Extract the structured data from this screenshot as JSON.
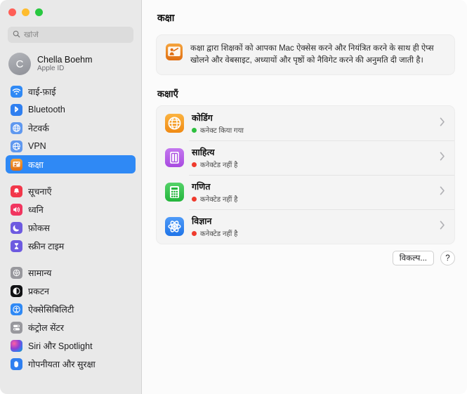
{
  "window": {
    "traffic_lights": [
      "close",
      "minimize",
      "maximize"
    ],
    "accent_color": "#2f89f5"
  },
  "sidebar": {
    "search": {
      "placeholder": "खोजें",
      "value": "",
      "icon": "search-icon"
    },
    "account": {
      "initial": "C",
      "name": "Chella Boehm",
      "subtitle": "Apple ID"
    },
    "groups": [
      {
        "items": [
          {
            "label": "वाई-फ़ाई",
            "icon": "wifi-icon",
            "color": "#2f89f5",
            "selected": false
          },
          {
            "label": "Bluetooth",
            "icon": "bluetooth-icon",
            "color": "#2f7ff0",
            "selected": false
          },
          {
            "label": "नेटवर्क",
            "icon": "network-globe-icon",
            "color": "#4a8ff0",
            "selected": false
          },
          {
            "label": "VPN",
            "icon": "vpn-globe-icon",
            "color": "#4a8ff0",
            "selected": false
          },
          {
            "label": "कक्षा",
            "icon": "classroom-icon",
            "color": "#e8801a",
            "selected": true
          }
        ]
      },
      {
        "items": [
          {
            "label": "सूचनाएँ",
            "icon": "notifications-bell-icon",
            "color": "#f2374a",
            "selected": false
          },
          {
            "label": "ध्वनि",
            "icon": "sound-speaker-icon",
            "color": "#f1355f",
            "selected": false
          },
          {
            "label": "फ़ोकस",
            "icon": "focus-moon-icon",
            "color": "#6d5ae0",
            "selected": false
          },
          {
            "label": "स्क्रीन टाइम",
            "icon": "screen-time-hourglass-icon",
            "color": "#6d5ae0",
            "selected": false
          }
        ]
      },
      {
        "items": [
          {
            "label": "सामान्य",
            "icon": "general-gear-icon",
            "color": "#98989d",
            "selected": false
          },
          {
            "label": "प्रकटन",
            "icon": "appearance-icon",
            "color": "#1c1c1e",
            "selected": false
          },
          {
            "label": "ऐक्सेसिबिलिटी",
            "icon": "accessibility-icon",
            "color": "#2f89f5",
            "selected": false
          },
          {
            "label": "कंट्रोल सेंटर",
            "icon": "control-center-icon",
            "color": "#98989d",
            "selected": false
          },
          {
            "label": "Siri और Spotlight",
            "icon": "siri-icon",
            "color": "#7b3fa0",
            "selected": false
          },
          {
            "label": "गोपनीयता और सुरक्षा",
            "icon": "privacy-hand-icon",
            "color": "#2f7ff0",
            "selected": false
          }
        ]
      }
    ]
  },
  "main": {
    "title": "कक्षा",
    "banner": {
      "icon": "classroom-icon",
      "text": "कक्षा द्वारा शिक्षकों को आपका Mac ऐक्सेस करने और नियंत्रित करने के साथ ही ऐप्स खोलने और वेबसाइट, अध्यायों और पृष्ठों को नैविगेट करने की अनुमति दी जाती है।"
    },
    "section_title": "कक्षाएँ",
    "classes": [
      {
        "name": "कोडिंग",
        "status": "कनेक्ट किया गया",
        "status_color": "#2ec03f",
        "icon": "globe-icon",
        "icon_color": "#f6a024",
        "chevron": "chevron-right-icon"
      },
      {
        "name": "साहित्य",
        "status": "कनेक्टेड नहीं है",
        "status_color": "#ef3b2d",
        "icon": "book-icon",
        "icon_color": "#b45ce8",
        "chevron": "chevron-right-icon"
      },
      {
        "name": "गणित",
        "status": "कनेक्टेड नहीं है",
        "status_color": "#ef3b2d",
        "icon": "calculator-icon",
        "icon_color": "#33c24d",
        "chevron": "chevron-right-icon"
      },
      {
        "name": "विज्ञान",
        "status": "कनेक्टेड नहीं है",
        "status_color": "#ef3b2d",
        "icon": "atom-icon",
        "icon_color": "#2f89f5",
        "chevron": "chevron-right-icon"
      }
    ],
    "options_button": "विकल्प...",
    "help_button": "?"
  }
}
